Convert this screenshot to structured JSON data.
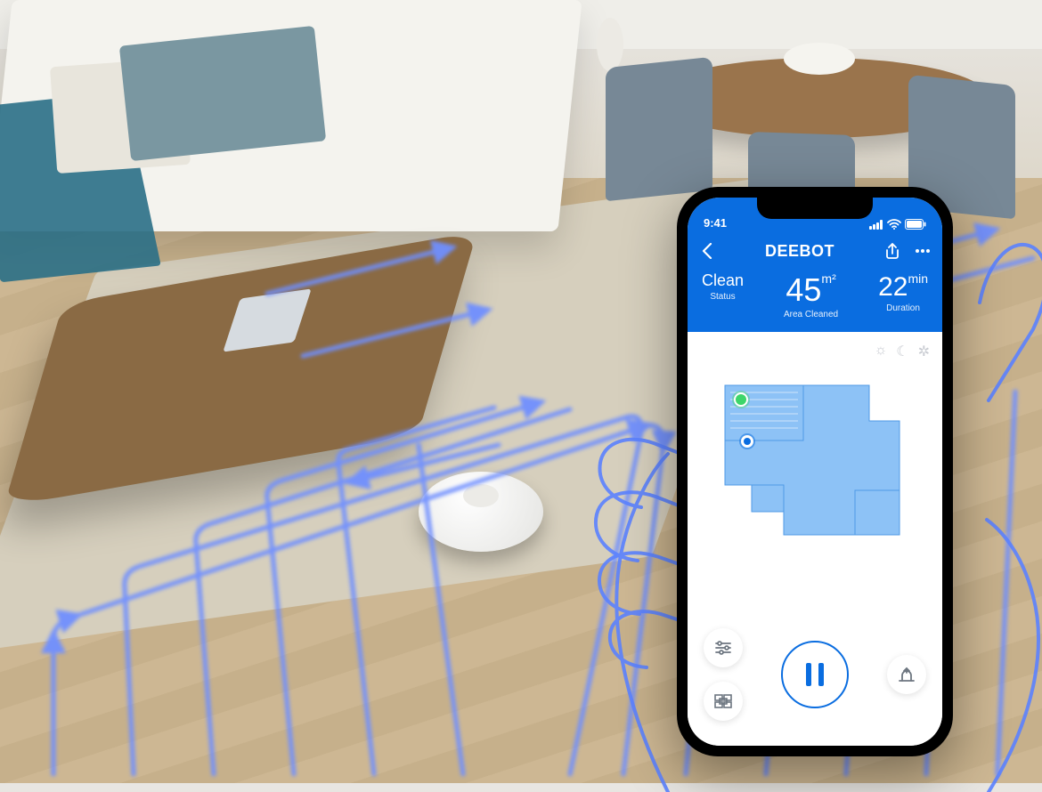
{
  "statusbar": {
    "time": "9:41",
    "signal_icon": "cellular-signal-icon",
    "wifi_icon": "wifi-icon",
    "battery_icon": "battery-icon"
  },
  "header": {
    "back_icon": "chevron-left-icon",
    "title": "DEEBOT",
    "share_icon": "share-icon",
    "more_icon": "more-icon"
  },
  "stats": {
    "left": {
      "label_top": "Clean",
      "label_bottom": "Status"
    },
    "center": {
      "value": "45",
      "unit": "m²",
      "sub": "Area Cleaned"
    },
    "right": {
      "value": "22",
      "unit": "min",
      "sub": "Duration"
    }
  },
  "map": {
    "mode_icons": [
      "sun-icon",
      "moon-icon",
      "fan-icon"
    ],
    "charger_icon": "charger-icon",
    "robot_icon": "robot-position-icon"
  },
  "controls": {
    "settings_icon": "sliders-icon",
    "zone_icon": "wall-icon",
    "play_pause_icon": "pause-icon",
    "dock_icon": "dock-icon"
  },
  "colors": {
    "brand": "#0a6de0",
    "accent_path": "#5b82ff"
  }
}
